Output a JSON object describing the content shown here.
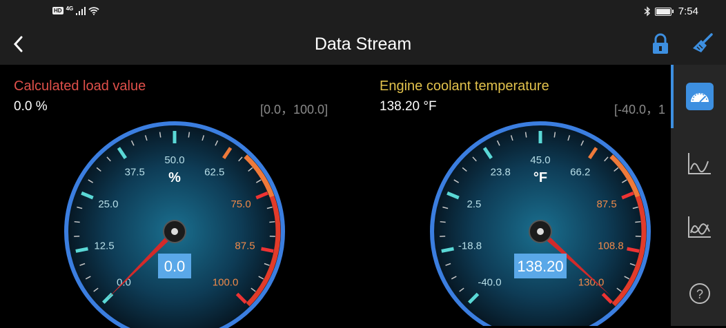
{
  "status": {
    "network": "4G",
    "hd": "HD",
    "time": "7:54"
  },
  "header": {
    "title": "Data Stream",
    "back_icon": "chevron-left-icon",
    "lock_icon": "lock-icon",
    "clear_icon": "broom-icon"
  },
  "colors": {
    "accent": "#3d8fe0",
    "load_label": "#e0504a",
    "coolant_label": "#e2c24c",
    "needle": "#d32a2a",
    "readout_bg": "#5aa8e8"
  },
  "gauges": [
    {
      "name": "Calculated load value",
      "value": "0.0 %",
      "range": "[0.0，100.0]",
      "unit": "%",
      "readout": "0.0",
      "needle_fraction": 0.0,
      "ticks": [
        "0.0",
        "12.5",
        "25.0",
        "37.5",
        "50.0",
        "62.5",
        "75.0",
        "87.5",
        "100.0"
      ]
    },
    {
      "name": "Engine coolant temperature",
      "value": "138.20 °F",
      "range": "[-40.0，1",
      "unit": "°F",
      "readout": "138.20",
      "needle_fraction": 0.9906,
      "ticks": [
        "-40.0",
        "-18.8",
        "2.5",
        "23.8",
        "45.0",
        "66.2",
        "87.5",
        "108.8",
        "130.0"
      ]
    }
  ],
  "sidebar": {
    "items": [
      "gauge-icon",
      "line-chart-icon",
      "multi-line-chart-icon",
      "help-icon"
    ]
  }
}
